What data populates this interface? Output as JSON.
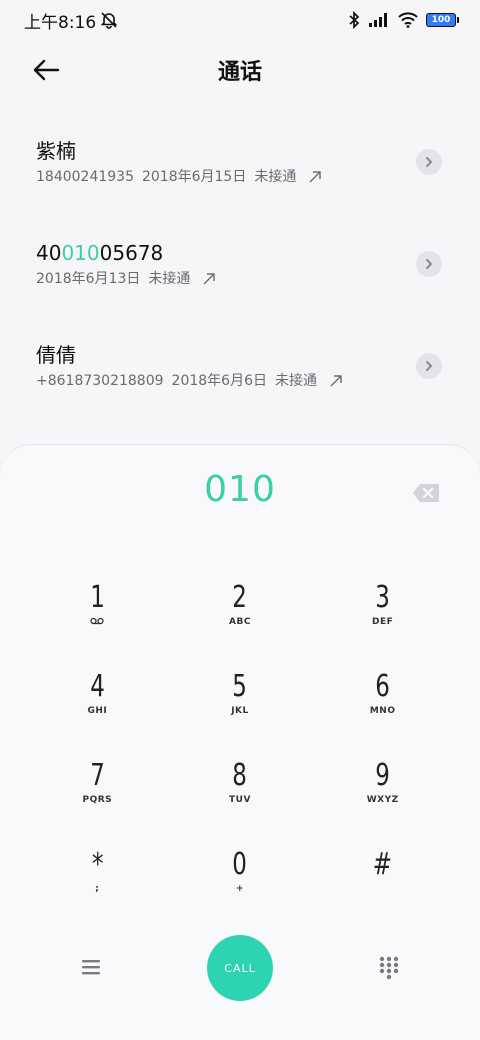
{
  "status_bar": {
    "time": "上午8:16",
    "battery": "100"
  },
  "header": {
    "title": "通话"
  },
  "calls": [
    {
      "name": "紫楠",
      "number": "18400241935",
      "date": "2018年6月15日",
      "status": "未接通"
    },
    {
      "name_prefix": "40",
      "name_highlight": "010",
      "name_suffix": "05678",
      "date": "2018年6月13日",
      "status": "未接通"
    },
    {
      "name": "倩倩",
      "number": "+8618730218809",
      "date": "2018年6月6日",
      "status": "未接通"
    }
  ],
  "dialpad": {
    "input_value": "010",
    "keys": [
      {
        "digit": "1",
        "letters": ""
      },
      {
        "digit": "2",
        "letters": "ABC"
      },
      {
        "digit": "3",
        "letters": "DEF"
      },
      {
        "digit": "4",
        "letters": "GHI"
      },
      {
        "digit": "5",
        "letters": "JKL"
      },
      {
        "digit": "6",
        "letters": "MNO"
      },
      {
        "digit": "7",
        "letters": "PQRS"
      },
      {
        "digit": "8",
        "letters": "TUV"
      },
      {
        "digit": "9",
        "letters": "WXYZ"
      },
      {
        "digit": "*",
        "letters": ";"
      },
      {
        "digit": "0",
        "letters": "+"
      },
      {
        "digit": "#",
        "letters": ""
      }
    ],
    "call_label": "CALL"
  },
  "colors": {
    "accent": "#3ccfa3",
    "call_button": "#2ed4b2"
  }
}
